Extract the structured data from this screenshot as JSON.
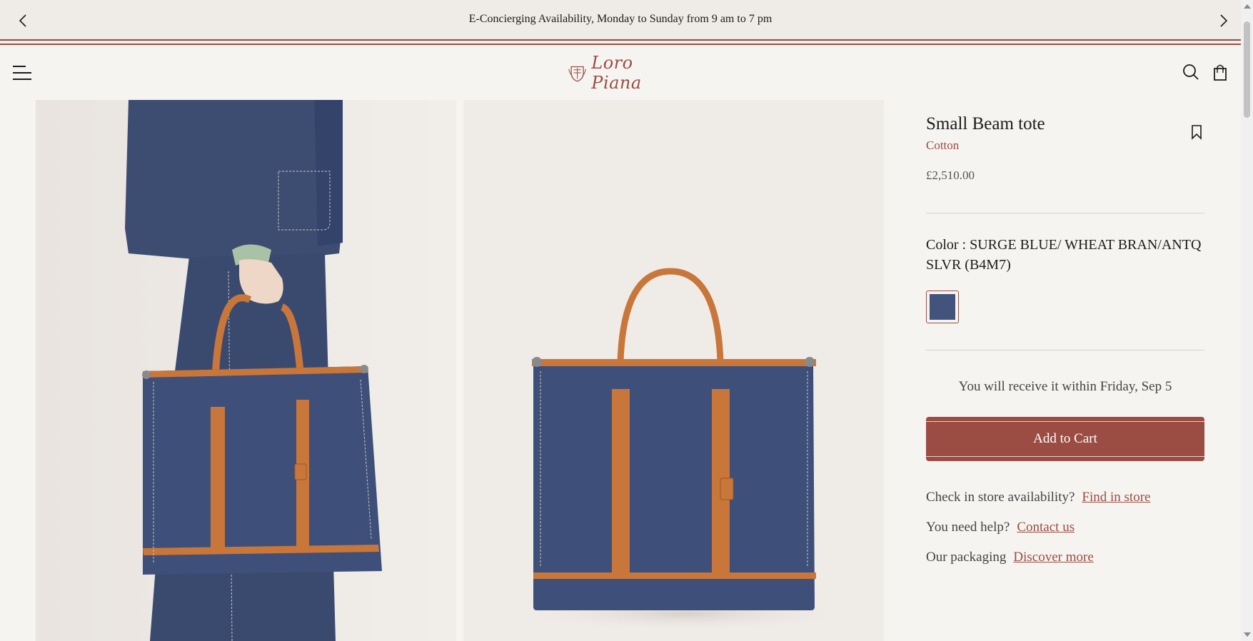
{
  "announcement": {
    "message": "E-Concierging Availability, Monday to Sunday from 9 am to 7 pm",
    "prev_icon": "chevron-left-icon",
    "next_icon": "chevron-right-icon"
  },
  "header": {
    "logo_text": "Loro Piana",
    "menu_icon": "hamburger-menu-icon",
    "search_icon": "search-icon",
    "bag_icon": "shopping-bag-icon"
  },
  "gallery": {
    "images": [
      {
        "alt": "model holding tote"
      },
      {
        "alt": "tote product shot"
      }
    ]
  },
  "product": {
    "title": "Small Beam tote",
    "material": "Cotton",
    "price": "£2,510.00",
    "color_label": "Color : SURGE BLUE/ WHEAT BRAN/ANTQ SLVR (B4M7)",
    "delivery": "You will receive it within Friday, Sep 5",
    "add_to_cart": "Add to Cart",
    "store_question": "Check in store availability?",
    "store_link": "Find in store",
    "help_question": "You need help?",
    "help_link": "Contact us",
    "packaging_question": "Our packaging",
    "packaging_link": "Discover more"
  },
  "colors": {
    "accent": "#9b4d44",
    "background": "#f6f4f1",
    "denim": "#3e5079",
    "leather": "#c9763a"
  }
}
